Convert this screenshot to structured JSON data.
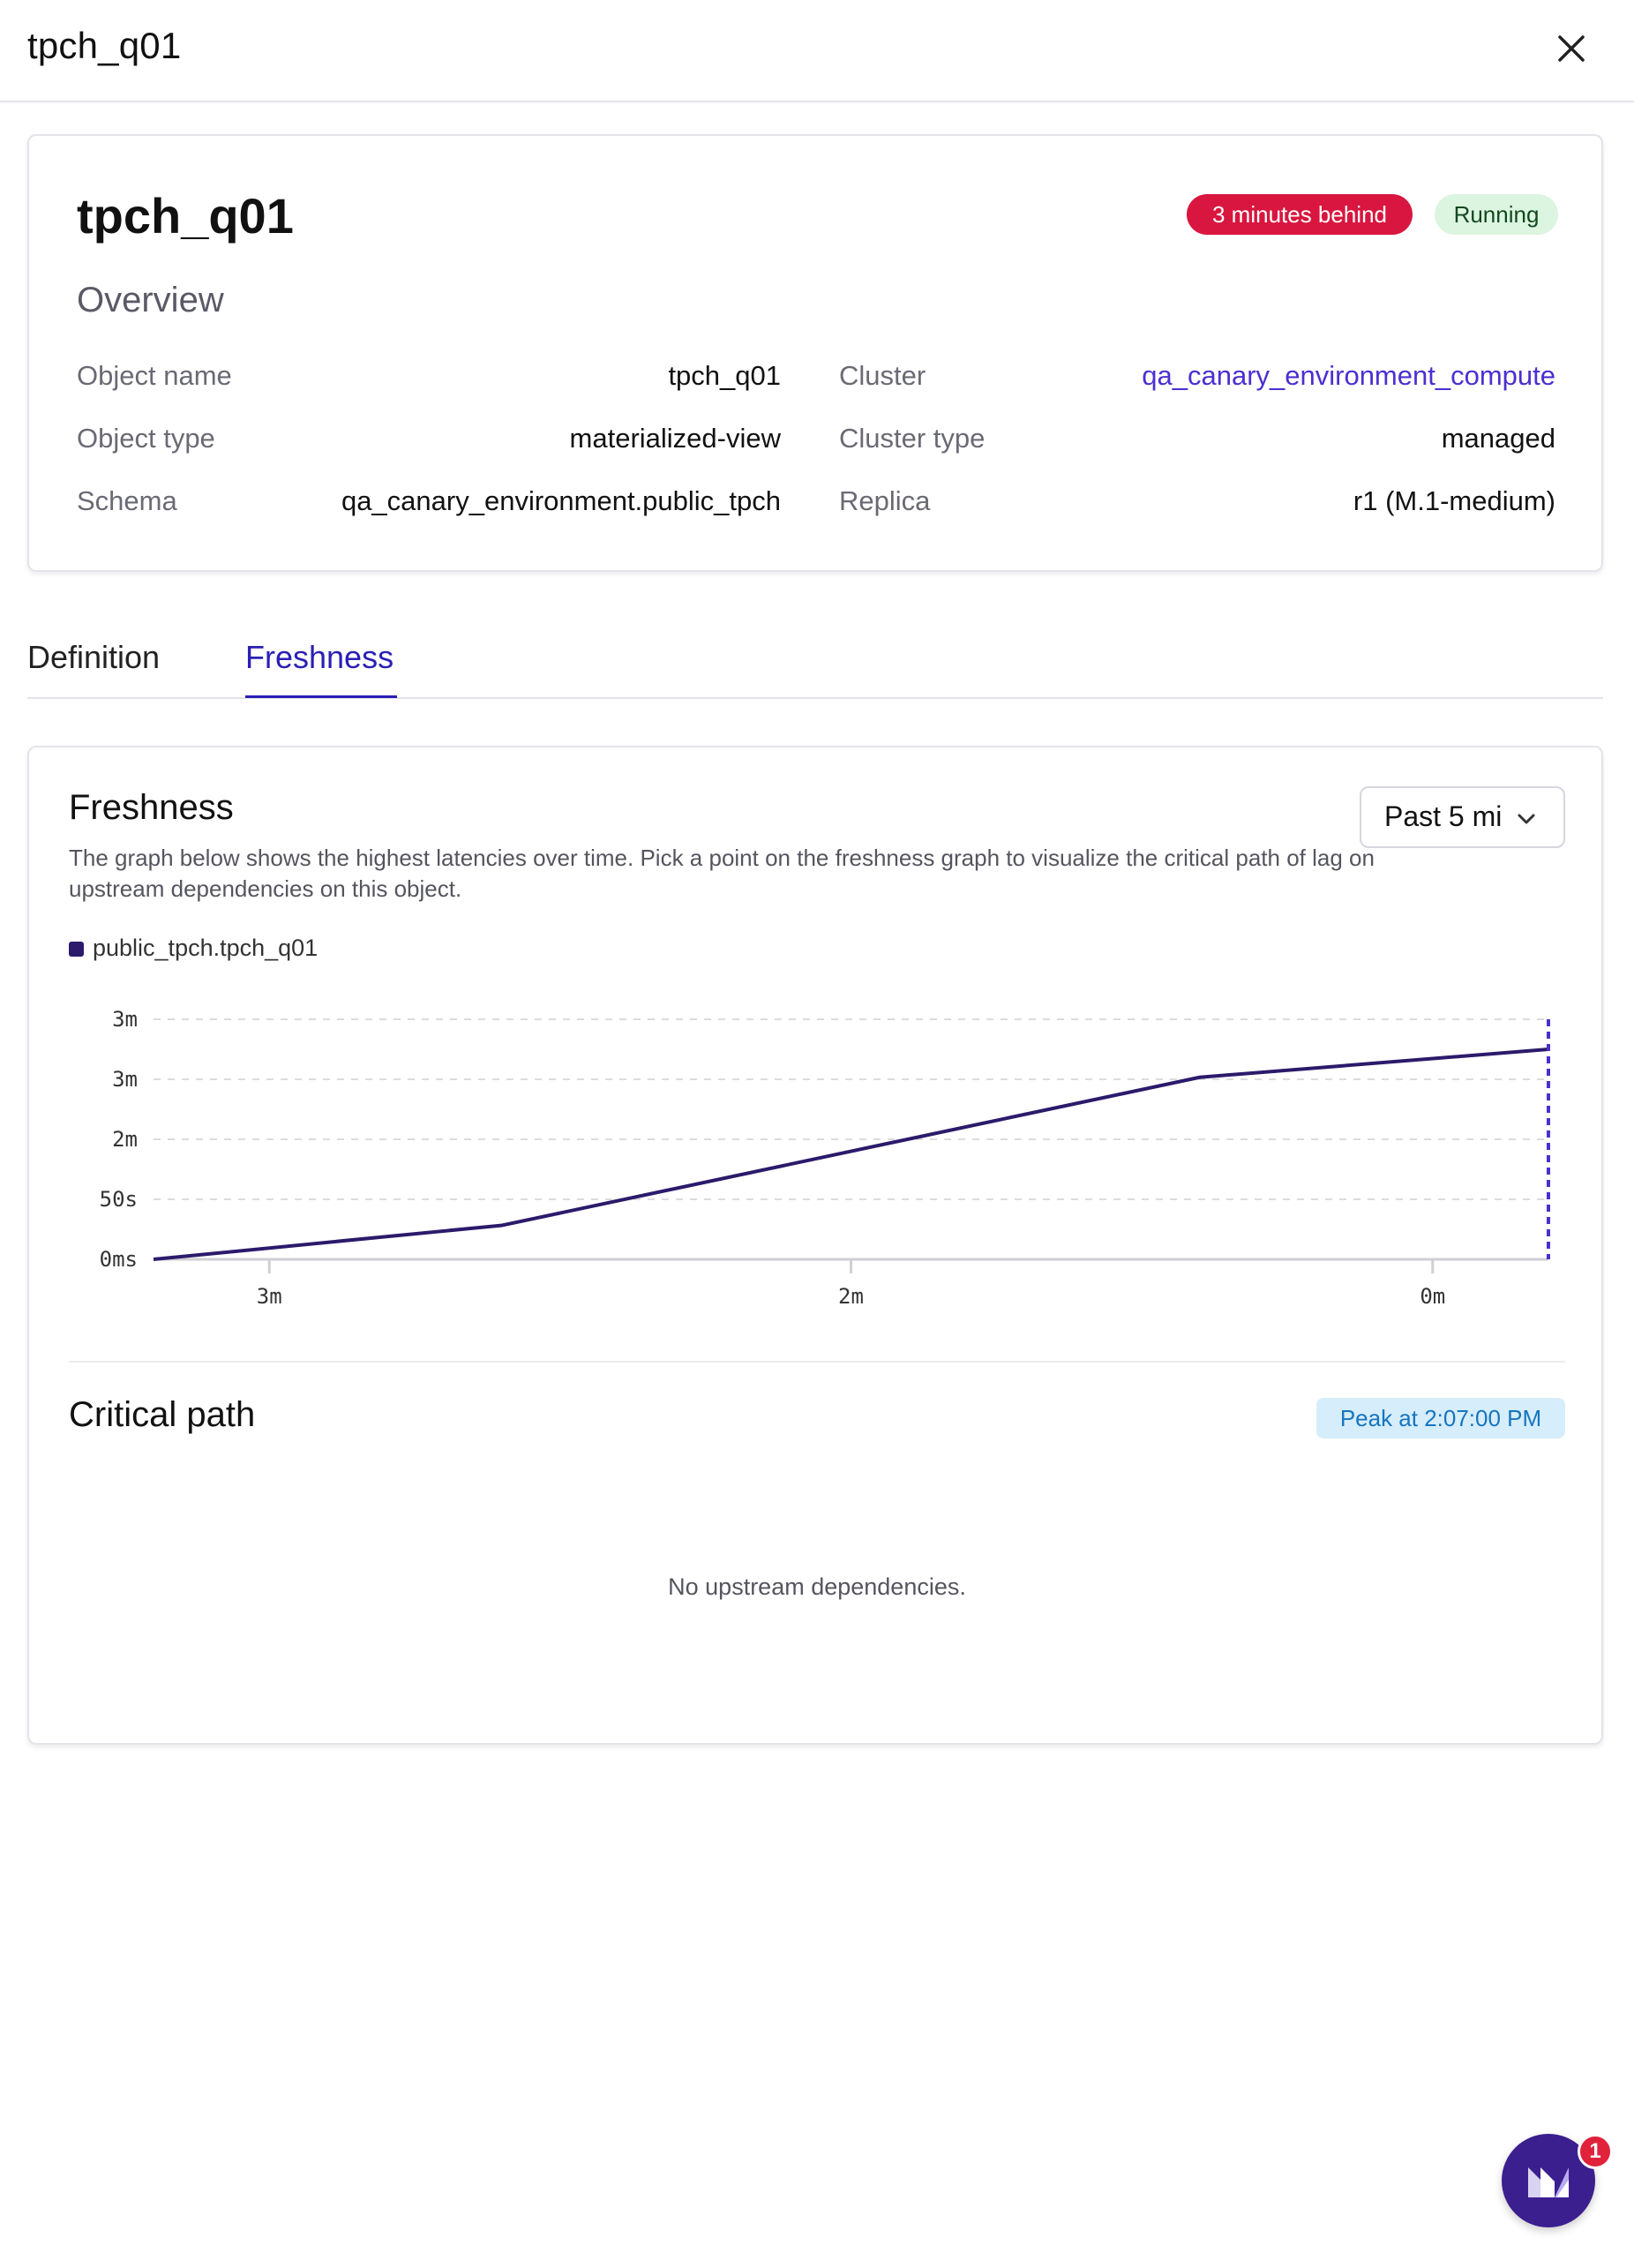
{
  "header": {
    "title": "tpch_q01",
    "close_icon": "close-icon"
  },
  "overview": {
    "object_title": "tpch_q01",
    "badges": {
      "behind": "3 minutes behind",
      "status": "Running",
      "behind_color": "#d8163f",
      "status_color": "#dcf5e0"
    },
    "heading": "Overview",
    "left": [
      {
        "label": "Object name",
        "value": "tpch_q01"
      },
      {
        "label": "Object type",
        "value": "materialized-view"
      },
      {
        "label": "Schema",
        "value": "qa_canary_environment.public_tpch"
      }
    ],
    "right": [
      {
        "label": "Cluster",
        "value": "qa_canary_environment_compute"
      },
      {
        "label": "Cluster type",
        "value": "managed"
      },
      {
        "label": "Replica",
        "value": "r1 (M.1-medium)"
      }
    ]
  },
  "tabs": {
    "definition": "Definition",
    "freshness": "Freshness",
    "active": "Freshness",
    "accent": "#2a1fb5"
  },
  "freshness": {
    "title": "Freshness",
    "description": "The graph below shows the highest latencies over time. Pick a point on the freshness graph to visualize the critical path of lag on upstream dependencies on this object.",
    "range_select": {
      "value": "Past 5 mi",
      "icon": "chevron-down-icon"
    },
    "legend": "public_tpch.tpch_q01",
    "line_color": "#2c1a6b"
  },
  "chart_data": {
    "type": "line",
    "series": [
      {
        "name": "public_tpch.tpch_q01",
        "points": [
          {
            "x": 0.0,
            "y": 0.0
          },
          {
            "x": 0.25,
            "y": 17.0
          },
          {
            "x": 0.75,
            "y": 91.0
          },
          {
            "x": 1.0,
            "y": 105.0
          }
        ]
      }
    ],
    "y_ticks": [
      {
        "value": 0,
        "label": "0ms"
      },
      {
        "value": 30,
        "label": "50s"
      },
      {
        "value": 60,
        "label": "2m"
      },
      {
        "value": 90,
        "label": "3m"
      },
      {
        "value": 120,
        "label": "3m"
      }
    ],
    "x_ticks": [
      {
        "value": 0.083,
        "label": "3m"
      },
      {
        "value": 0.5,
        "label": "2m"
      },
      {
        "value": 0.917,
        "label": "0m"
      }
    ],
    "ylim": [
      0,
      120
    ],
    "xlim": [
      0,
      1
    ],
    "selected_x": 1.0,
    "grid": true
  },
  "critical_path": {
    "title": "Critical path",
    "peak": "Peak at 2:07:00 PM",
    "empty": "No upstream dependencies."
  },
  "chat": {
    "icon": "materialize-logo-icon",
    "badge_count": "1"
  }
}
